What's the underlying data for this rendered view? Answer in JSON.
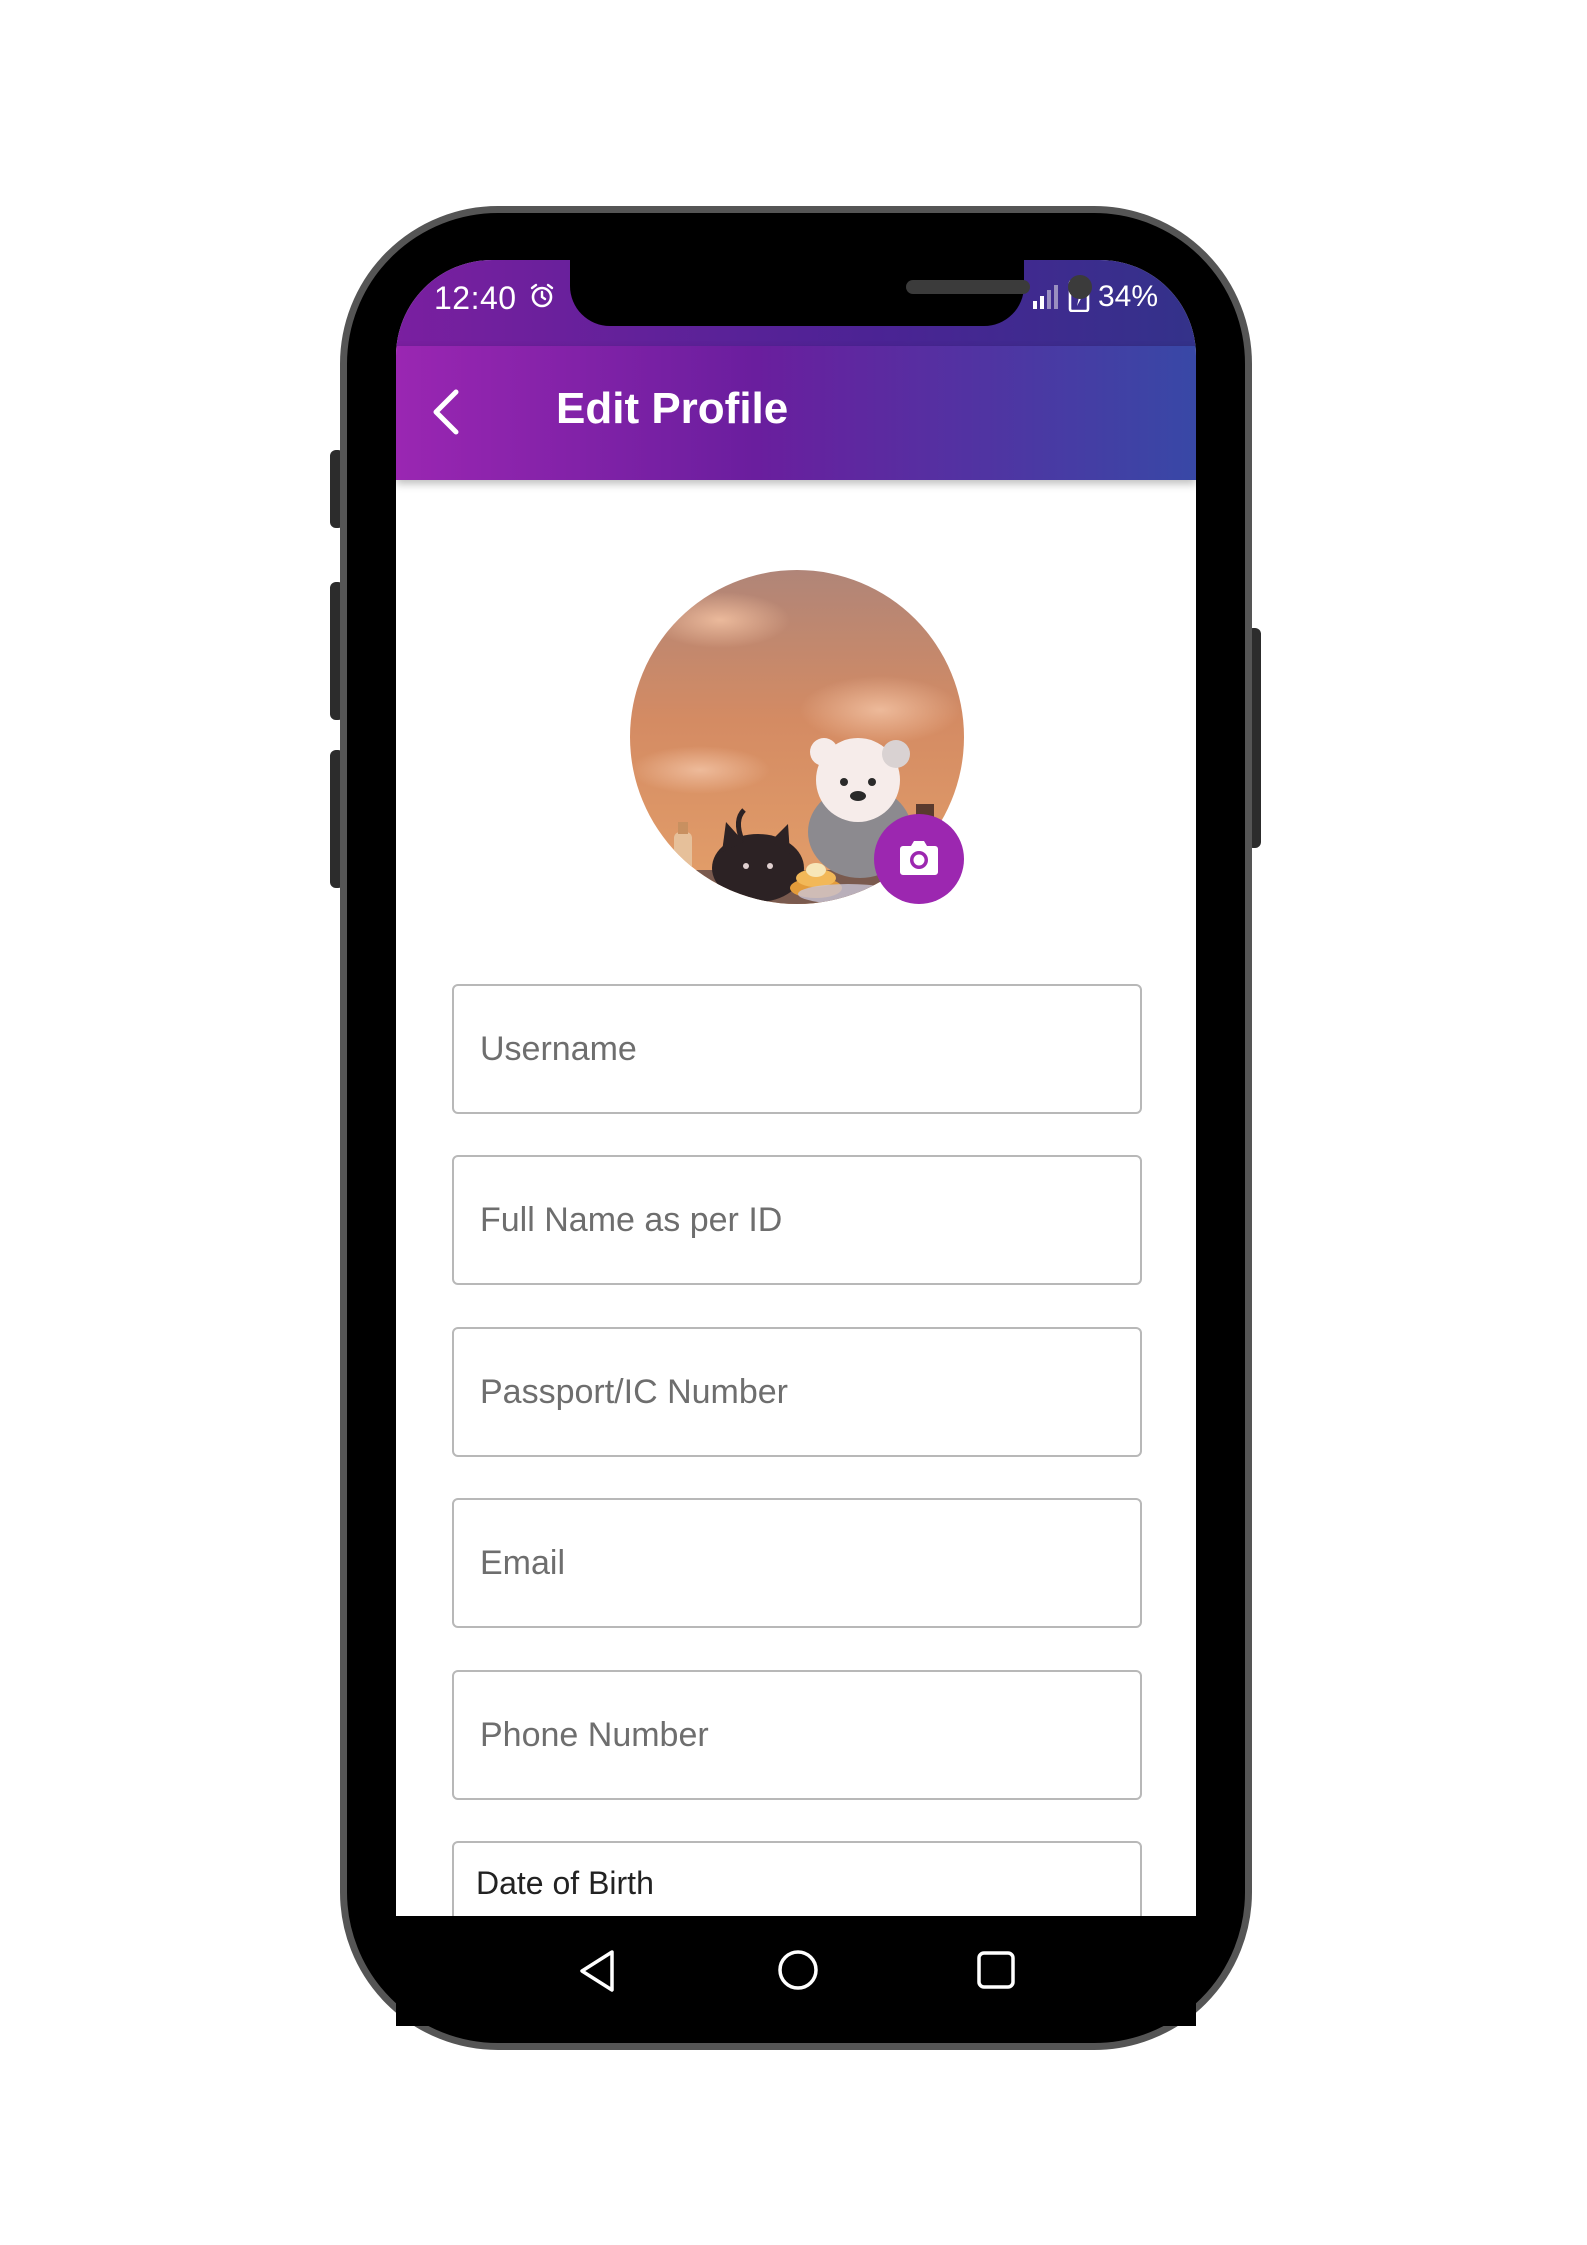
{
  "status_bar": {
    "time": "12:40",
    "battery": "34%",
    "icons": [
      "alarm-icon",
      "signal-icon",
      "battery-charging-icon"
    ]
  },
  "app_bar": {
    "title": "Edit Profile",
    "back_icon": "chevron-left-icon"
  },
  "profile": {
    "avatar_icon": "profile-photo",
    "change_photo_icon": "camera-icon"
  },
  "form": {
    "username_placeholder": "Username",
    "fullname_placeholder": "Full Name as per ID",
    "passport_placeholder": "Passport/IC Number",
    "email_placeholder": "Email",
    "phone_placeholder": "Phone Number",
    "dob_label": "Date of Birth"
  },
  "nav": {
    "icons": [
      "nav-back-icon",
      "nav-home-icon",
      "nav-recents-icon"
    ]
  },
  "colors": {
    "accent": "#9c27b0",
    "appbar_start": "#9a26b2",
    "appbar_end": "#3848a6"
  }
}
